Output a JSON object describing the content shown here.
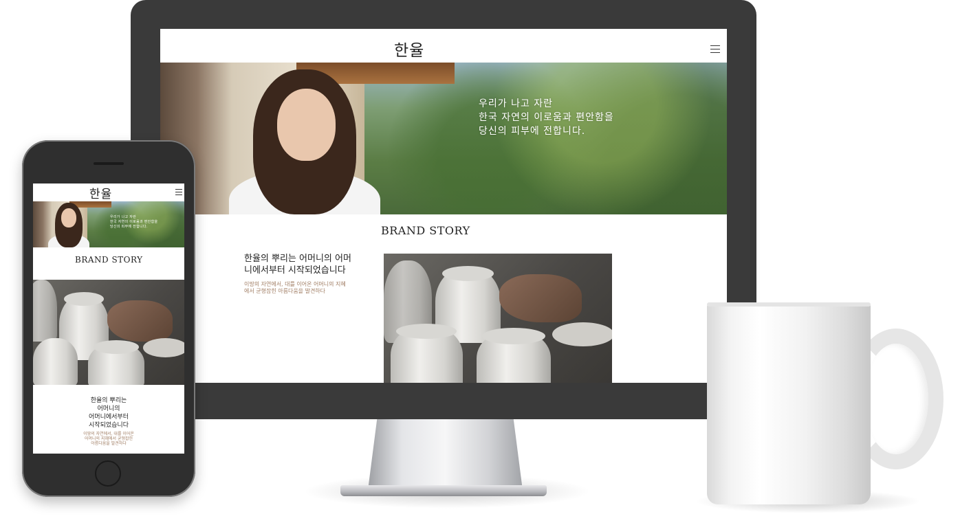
{
  "brand": {
    "logo_text": "한율"
  },
  "hero": {
    "copy_lines": [
      "우리가 나고 자란",
      "한국 자연의 이로움과 편안함을",
      "당신의 피부에 전합니다."
    ]
  },
  "section": {
    "title": "BRAND STORY"
  },
  "story": {
    "desktop_heading_lines": [
      "한율의 뿌리는 어머니의 어머",
      "니에서부터 시작되었습니다"
    ],
    "desktop_desc_lines": [
      "이땅의 자연에서, 대를 이어온 어머니의 지혜",
      "에서 균형잡힌 아름다움을 발견하다"
    ],
    "mobile_heading_lines": [
      "한율의 뿌리는",
      "어머니의",
      "어머니에서부터",
      "시작되었습니다"
    ],
    "mobile_desc_lines": [
      "이땅의 자연에서, 대를 이어온",
      "어머니의 지혜에서 균형잡힌",
      "아름다움을 발견하다"
    ]
  },
  "icons": {
    "menu": "hamburger-menu-icon"
  },
  "colors": {
    "bezel": "#3a3a3a",
    "phone_body": "#2f2f2f",
    "accent_desc": "#a07d63",
    "text_dark": "#222222"
  }
}
